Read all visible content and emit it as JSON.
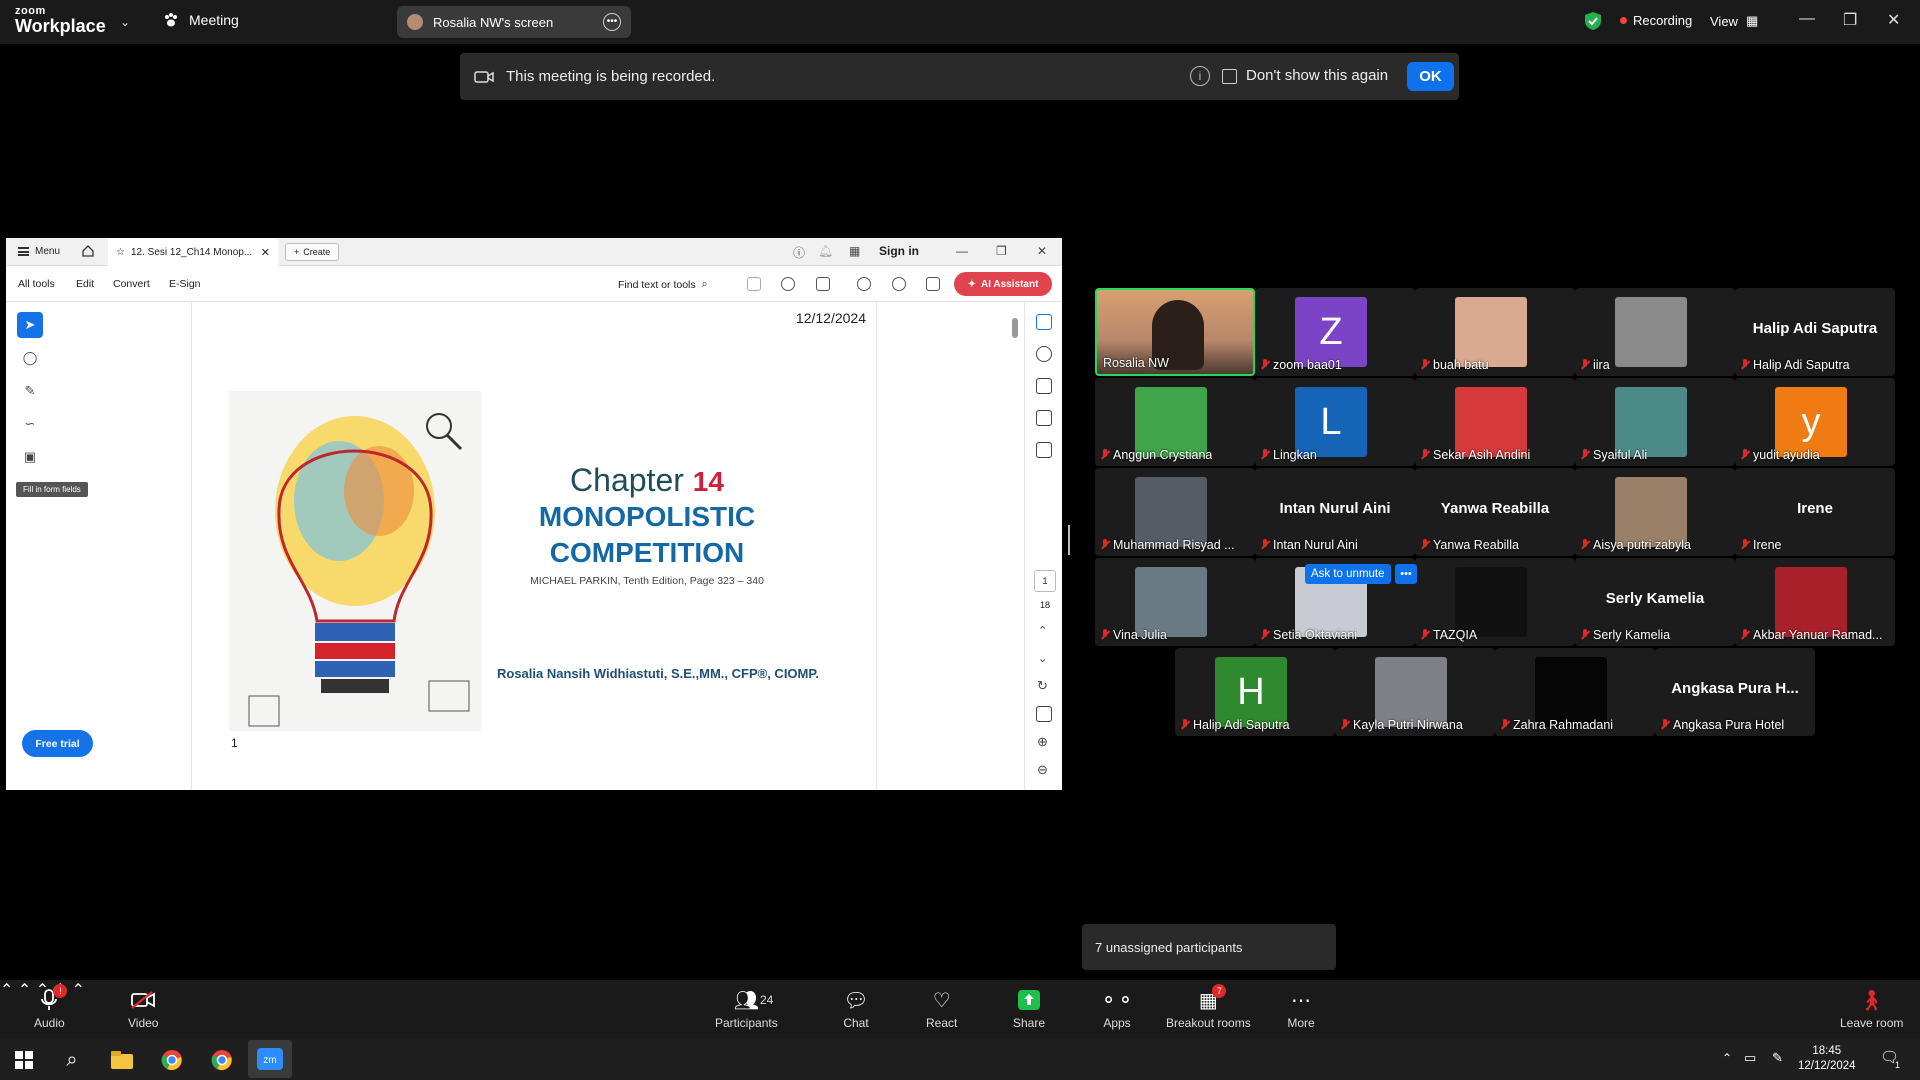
{
  "topbar": {
    "logo_line1": "zoom",
    "logo_line2": "Workplace",
    "meeting_label": "Meeting",
    "screen_label": "Rosalia NW's screen",
    "recording_label": "Recording",
    "view_label": "View"
  },
  "banner": {
    "message": "This meeting is being recorded.",
    "dont_show": "Don't show this again",
    "ok": "OK"
  },
  "pdf": {
    "menu": "Menu",
    "tab_title": "12. Sesi 12_Ch14 Monop...",
    "create": "Create",
    "sign_in": "Sign in",
    "tools": [
      "All tools",
      "Edit",
      "Convert",
      "E-Sign"
    ],
    "find": "Find text or tools",
    "ai_assistant": "AI Assistant",
    "tooltip": "Fill in form fields",
    "free_trial": "Free trial",
    "date": "12/12/2024",
    "chapter_word": "Chapter",
    "chapter_num": "14",
    "title_line1": "MONOPOLISTIC",
    "title_line2": "COMPETITION",
    "subtitle": "MICHAEL PARKIN, Tenth Edition, Page 323 – 340",
    "author": "Rosalia Nansih Widhiastuti, S.E.,MM., CFP®, CIOMP.",
    "page_num": "1",
    "current_page": "1",
    "total_pages": "18"
  },
  "participants": [
    {
      "name": "Rosalia NW",
      "muted": false,
      "kind": "video",
      "color": "#b9876a"
    },
    {
      "name": "zoom baa01",
      "muted": true,
      "kind": "letter",
      "letter": "Z",
      "color": "#7b44c6"
    },
    {
      "name": "buah batu",
      "muted": true,
      "kind": "photo",
      "color": "#d9a990"
    },
    {
      "name": "iira",
      "muted": true,
      "kind": "photo",
      "color": "#8a8a8a"
    },
    {
      "name": "Halip Adi Saputra",
      "muted": true,
      "kind": "text"
    },
    {
      "name": "Anggun Crystiana",
      "muted": true,
      "kind": "photo",
      "color": "#3fa44a"
    },
    {
      "name": "Lingkan",
      "muted": true,
      "kind": "letter",
      "letter": "L",
      "color": "#1664b8"
    },
    {
      "name": "Sekar Asih Andini",
      "muted": true,
      "kind": "photo",
      "color": "#d63a3a"
    },
    {
      "name": "Syaiful Ali",
      "muted": true,
      "kind": "photo",
      "color": "#4c8a8a"
    },
    {
      "name": "yudit ayudia",
      "muted": true,
      "kind": "letter",
      "letter": "y",
      "color": "#f07b13"
    },
    {
      "name": "Muhammad Risyad ...",
      "muted": true,
      "kind": "photo",
      "color": "#555c66"
    },
    {
      "name": "Intan Nurul Aini",
      "muted": true,
      "kind": "text"
    },
    {
      "name": "Yanwa Reabilla",
      "muted": true,
      "kind": "text"
    },
    {
      "name": "Aisya putri zabyla",
      "muted": true,
      "kind": "photo",
      "color": "#9a8068"
    },
    {
      "name": "Irene",
      "muted": true,
      "kind": "text"
    },
    {
      "name": "Vina Julia",
      "muted": true,
      "kind": "photo",
      "color": "#6a7a85"
    },
    {
      "name": "Setia Oktaviani",
      "muted": true,
      "kind": "photo",
      "color": "#c8ccd2"
    },
    {
      "name": "TAZQIA",
      "muted": true,
      "kind": "photo",
      "color": "#111111"
    },
    {
      "name": "Serly Kamelia",
      "muted": true,
      "kind": "text"
    },
    {
      "name": "Akbar Yanuar Ramad...",
      "muted": true,
      "kind": "photo",
      "color": "#a8202a"
    },
    {
      "name": "Halip Adi Saputra",
      "muted": true,
      "kind": "letter",
      "letter": "H",
      "color": "#2f8a2f"
    },
    {
      "name": "Kayla Putri Nirwana",
      "muted": true,
      "kind": "photo",
      "color": "#7f7f86"
    },
    {
      "name": "Zahra Rahmadani",
      "muted": true,
      "kind": "photo",
      "color": "#050505"
    },
    {
      "name": "Angkasa Pura Hotel",
      "muted": true,
      "kind": "text",
      "big": "Angkasa Pura H..."
    }
  ],
  "ask_to_unmute": "Ask to unmute",
  "unassigned": "7 unassigned participants",
  "toolbar": {
    "audio": "Audio",
    "video": "Video",
    "participants": "Participants",
    "participant_count": "24",
    "chat": "Chat",
    "react": "React",
    "share": "Share",
    "apps": "Apps",
    "breakout": "Breakout rooms",
    "breakout_badge": "7",
    "more": "More",
    "leave": "Leave room"
  },
  "taskbar": {
    "time": "18:45",
    "date": "12/12/2024",
    "notif_count": "1"
  }
}
